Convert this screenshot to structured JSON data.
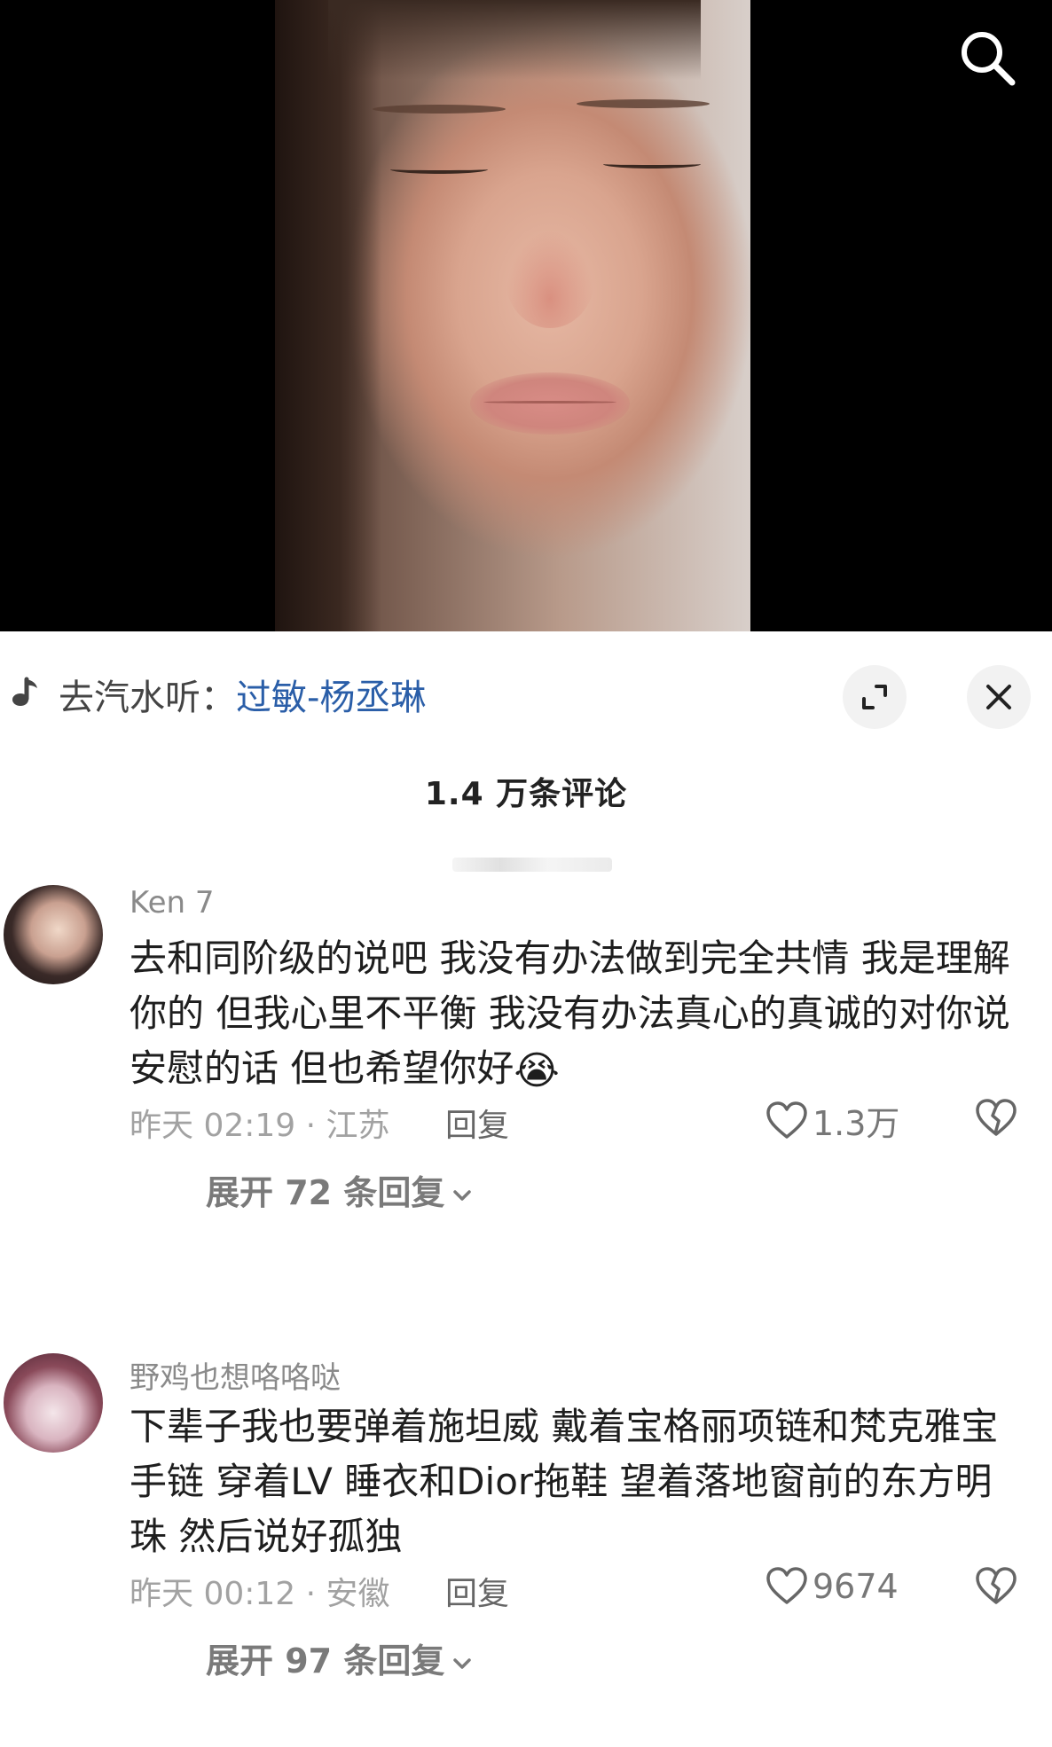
{
  "video": {
    "search_icon": "search-icon"
  },
  "music": {
    "icon": "music-note-icon",
    "prefix": "去汽水听：",
    "song": "过敏-杨丞琳",
    "expand_icon": "expand-icon",
    "close_icon": "close-icon"
  },
  "comments_header": {
    "count": "1.4 万条评论"
  },
  "comments": [
    {
      "username": "Ken 7",
      "text": "去和同阶级的说吧 我没有办法做到完全共情 我是理解你的 但我心里不平衡 我没有办法真心的真诚的对你说安慰的话 但也希望你好",
      "emoji": "😭",
      "time_location": "昨天 02:19 · 江苏",
      "reply_label": "回复",
      "likes": "1.3万",
      "expand_replies": "展开 72 条回复"
    },
    {
      "username": "野鸡也想咯咯哒",
      "text": "下辈子我也要弹着施坦威 戴着宝格丽项链和梵克雅宝手链 穿着LV 睡衣和Dior拖鞋  望着落地窗前的东方明珠 然后说好孤独",
      "time_location": "昨天 00:12 · 安徽",
      "reply_label": "回复",
      "likes": "9674",
      "expand_replies": "展开 97 条回复"
    }
  ]
}
